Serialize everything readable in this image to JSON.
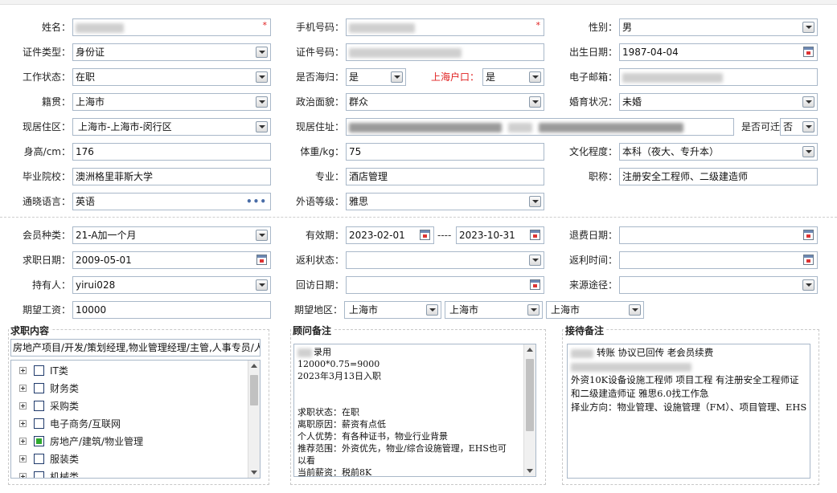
{
  "personal": {
    "name_label": "姓名：",
    "phone_label": "手机号码：",
    "gender_label": "性别：",
    "gender_value": "男",
    "idtype_label": "证件类型：",
    "idtype_value": "身份证",
    "idno_label": "证件号码：",
    "birth_label": "出生日期：",
    "birth_value": "1987-04-04",
    "workstatus_label": "工作状态：",
    "workstatus_value": "在职",
    "returnee_label": "是否海归：",
    "returnee_value": "是",
    "hukou_label": "上海户口：",
    "hukou_value": "是",
    "email_label": "电子邮箱：",
    "native_label": "籍贯：",
    "native_value": "上海市",
    "political_label": "政治面貌：",
    "political_value": "群众",
    "marital_label": "婚育状况：",
    "marital_value": "未婚",
    "curarea_label": "现居住区：",
    "curarea_value": "上海市-上海市-闵行区",
    "curaddr_label": "现居住址：",
    "relocate_label": "是否可迁",
    "relocate_value": "否",
    "height_label": "身高/cm：",
    "height_value": "176",
    "weight_label": "体重/kg：",
    "weight_value": "75",
    "edu_label": "文化程度：",
    "edu_value": "本科（夜大、专升本）",
    "school_label": "毕业院校：",
    "school_value": "澳洲格里菲斯大学",
    "major_label": "专业：",
    "major_value": "酒店管理",
    "title_label": "职称：",
    "title_value": "注册安全工程师、二级建造师",
    "lang_label": "通晓语言：",
    "lang_value": "英语",
    "langlevel_label": "外语等级：",
    "langlevel_value": "雅思"
  },
  "membership": {
    "type_label": "会员种类：",
    "type_value": "21-A加一个月",
    "valid_label": "有效期：",
    "valid_from": "2023-02-01",
    "valid_sep": "----",
    "valid_to": "2023-10-31",
    "refund_label": "退费日期：",
    "jobdate_label": "求职日期：",
    "jobdate_value": "2009-05-01",
    "rebate_status_label": "返利状态：",
    "rebate_time_label": "返利时间：",
    "holder_label": "持有人：",
    "holder_value": "yirui028",
    "visit_label": "回访日期：",
    "source_label": "来源途径：",
    "salary_label": "期望工资：",
    "salary_value": "10000",
    "region_label": "期望地区：",
    "region1": "上海市",
    "region2": "上海市",
    "region3": "上海市"
  },
  "job_panel": {
    "title": "求职内容",
    "summary": "房地产项目/开发/策划经理,物业管理经理/主管,人事专员/人",
    "tree": [
      {
        "label": "IT类",
        "checked": "none"
      },
      {
        "label": "财务类",
        "checked": "none"
      },
      {
        "label": "采购类",
        "checked": "none"
      },
      {
        "label": "电子商务/互联网",
        "checked": "none"
      },
      {
        "label": "房地产/建筑/物业管理",
        "checked": "partial"
      },
      {
        "label": "服装类",
        "checked": "none"
      },
      {
        "label": "机械类",
        "checked": "none"
      }
    ]
  },
  "advisor_panel": {
    "title": "顾问备注",
    "lines": [
      "录用",
      "12000*0.75=9000",
      "2023年3月13日入职",
      "",
      "",
      "求职状态：在职",
      "离职原因：薪资有点低",
      "个人优势：有各种证书，物业行业背景",
      "推荐范围：外资优先，物业/综合设施管理，EHS也可",
      "以看",
      "当前薪资：税前8K"
    ]
  },
  "reception_panel": {
    "title": "接待备注",
    "lines": [
      "转账 协议已回传 老会员续费",
      "",
      "外资10K设备设施工程师 项目工程 有注册安全工程师证",
      "和二级建造师证 雅思6.0找工作急",
      "择业方向：物业管理、设施管理（FM）、项目管理、EHS"
    ]
  }
}
